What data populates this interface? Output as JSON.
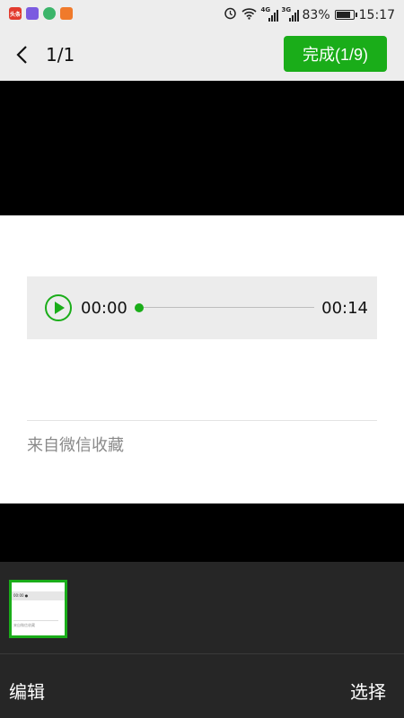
{
  "status_bar": {
    "apps": [
      "头条",
      "",
      "",
      ""
    ],
    "network_4g": "4G",
    "network_3g": "3G",
    "battery": "83%",
    "time": "15:17"
  },
  "header": {
    "counter": "1/1",
    "done_label": "完成(1/9)"
  },
  "player": {
    "current_time": "00:00",
    "duration": "00:14",
    "progress": 0
  },
  "content": {
    "source_text": "来自微信收藏"
  },
  "thumbnail": {
    "time": "00:00",
    "caption": "来自微信收藏"
  },
  "toolbar": {
    "edit_label": "编辑",
    "select_label": "选择"
  },
  "colors": {
    "accent": "#1aad19",
    "bar_bg": "#ededed",
    "panel_bg": "#262626"
  }
}
